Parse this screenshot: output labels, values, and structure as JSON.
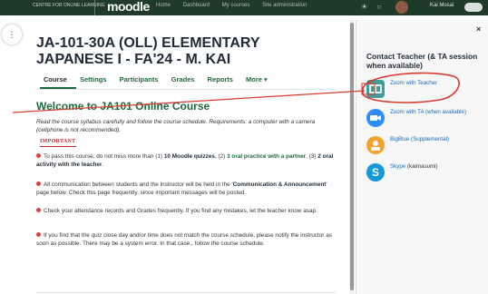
{
  "navbar": {
    "org": "CENTRE FOR ONLINE LEARNING",
    "logo": "moodle",
    "links": [
      "Home",
      "Dashboard",
      "My courses",
      "Site administration"
    ],
    "user": "Kai Mosai"
  },
  "course": {
    "title": "JA-101-30A (OLL) ELEMENTARY JAPANESE I - FA'24 - M. KAI",
    "tabs": [
      "Course",
      "Settings",
      "Participants",
      "Grades",
      "Reports",
      "More ▾"
    ],
    "active_tab": "Course"
  },
  "content": {
    "heading": "Welcome to JA101 Online Course",
    "intro": "Read the course syllabus carefully and follow the course schedule.  Requirements: a computer with a camera (cellphone is not recommended).",
    "important_label": "IMPORTANT",
    "b1_pre": "To pass this course, do not miss more than (1) ",
    "b1_quizzes": "10 Moodle quizzes",
    "b1_mid": ", (2) ",
    "b1_oral": "3 oral practice with a partner",
    "b1_mid2": ", (3) ",
    "b1_activity": "2 oral activity with the teacher",
    "b1_end": ".",
    "b2_pre": "All communication between students and the instructor will be held in the '",
    "b2_link": "Communication & Announcement",
    "b2_end": "' page below. Check this page frequently, since important messages will be posted.",
    "b3": "Check your attendance records and Grades frequently. If you find any mistakes, let the teacher know asap.",
    "b4": "If you find that the quiz close day and/or time does not match the course schedule, please notify the instructor as soon as possible. There may be a system error. In that case,, follow the course schedule."
  },
  "drawer": {
    "title": "Contact Teacher (& TA session when available)",
    "close": "×",
    "items": [
      {
        "label": "Zoom with Teacher",
        "note": ""
      },
      {
        "label": "Zoom with TA (when available)",
        "note": ""
      },
      {
        "label": "BigBlue (Supplemental)",
        "note": ""
      },
      {
        "label": "Skype",
        "note": " (kaimasumi)"
      }
    ]
  },
  "colors": {
    "navbar": "#1e3a28",
    "accent_green": "#1e6a3a",
    "link_blue": "#1a6bb8",
    "annotation_red": "#d63b2f"
  }
}
